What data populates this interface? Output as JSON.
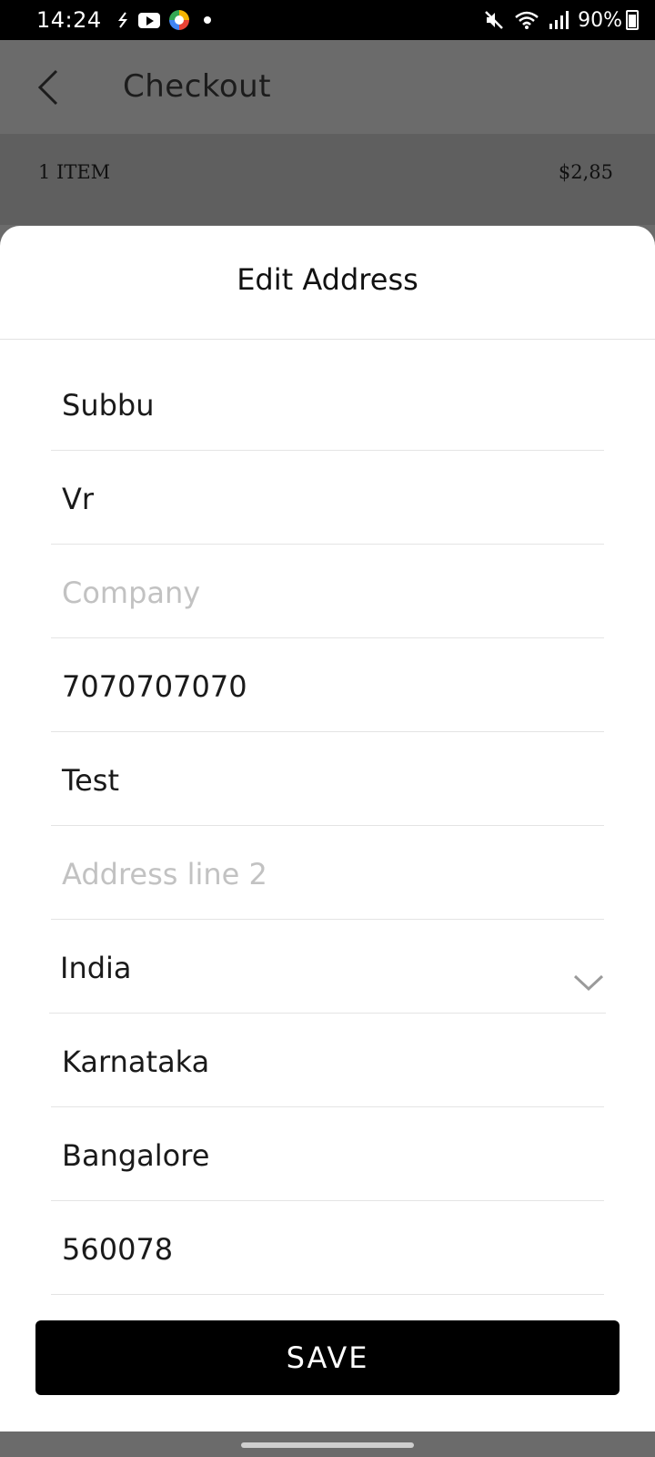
{
  "status_bar": {
    "time": "14:24",
    "battery": "90%",
    "icons": [
      "link-icon",
      "youtube-icon",
      "app-icon",
      "notification-dot-icon",
      "mute-icon",
      "wifi-icon",
      "signal-icon",
      "battery-icon"
    ]
  },
  "header": {
    "title": "Checkout",
    "back_icon": "back-arrow-icon"
  },
  "order_summary": {
    "items_label": "1 ITEM",
    "total": "$2,85"
  },
  "sheet": {
    "title": "Edit Address",
    "fields": {
      "first_name": "Subbu",
      "last_name": "Vr",
      "company_placeholder": "Company",
      "phone": "7070707070",
      "address_line1": "Test",
      "address_line2_placeholder": "Address line 2",
      "country": "India",
      "state": "Karnataka",
      "city": "Bangalore",
      "postcode": "560078"
    },
    "save_label": "SAVE"
  },
  "colors": {
    "overlay": "#6b6b6b",
    "sheet_bg": "#ffffff",
    "button_bg": "#000000",
    "placeholder": "#c2c2c2"
  }
}
